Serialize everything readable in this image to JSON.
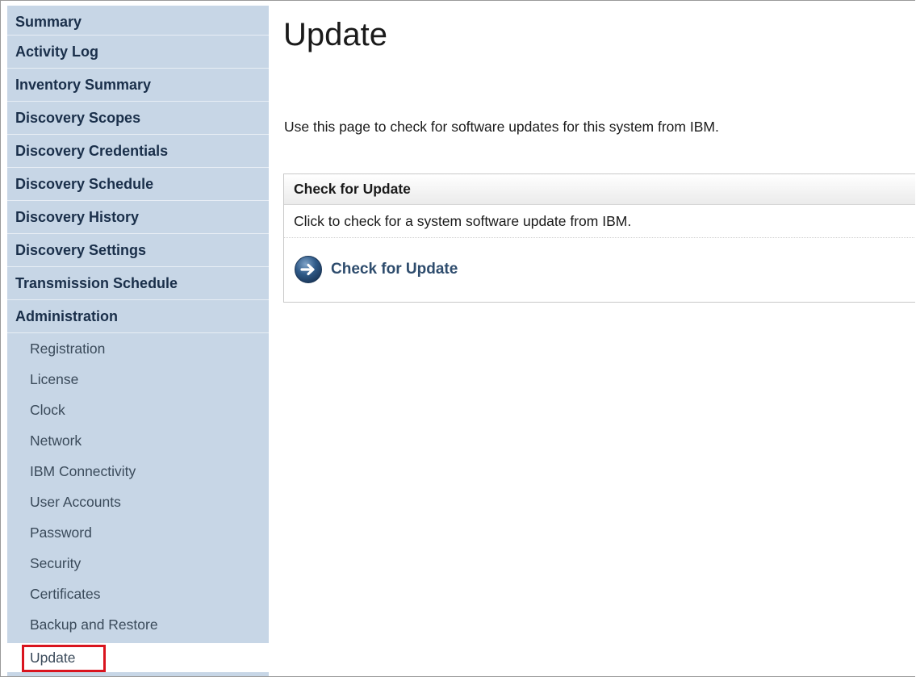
{
  "sidebar": {
    "main_items": [
      {
        "label": "Summary"
      },
      {
        "label": "Activity Log"
      },
      {
        "label": "Inventory Summary"
      },
      {
        "label": "Discovery Scopes"
      },
      {
        "label": "Discovery Credentials"
      },
      {
        "label": "Discovery Schedule"
      },
      {
        "label": "Discovery History"
      },
      {
        "label": "Discovery Settings"
      },
      {
        "label": "Transmission Schedule"
      },
      {
        "label": "Administration"
      }
    ],
    "sub_items": [
      {
        "label": "Registration"
      },
      {
        "label": "License"
      },
      {
        "label": "Clock"
      },
      {
        "label": "Network"
      },
      {
        "label": "IBM Connectivity"
      },
      {
        "label": "User Accounts"
      },
      {
        "label": "Password"
      },
      {
        "label": "Security"
      },
      {
        "label": "Certificates"
      },
      {
        "label": "Backup and Restore"
      },
      {
        "label": "Update",
        "active": true
      }
    ]
  },
  "main": {
    "title": "Update",
    "description": "Use this page to check for software updates for this system from IBM.",
    "panel": {
      "header": "Check for Update",
      "text": "Click to check for a system software update from IBM.",
      "action_label": "Check for Update",
      "action_icon": "arrow-right-circle-icon"
    }
  },
  "colors": {
    "sidebar_bg": "#c7d6e6",
    "highlight_border": "#d9141e",
    "action_text": "#2e4c6d"
  }
}
